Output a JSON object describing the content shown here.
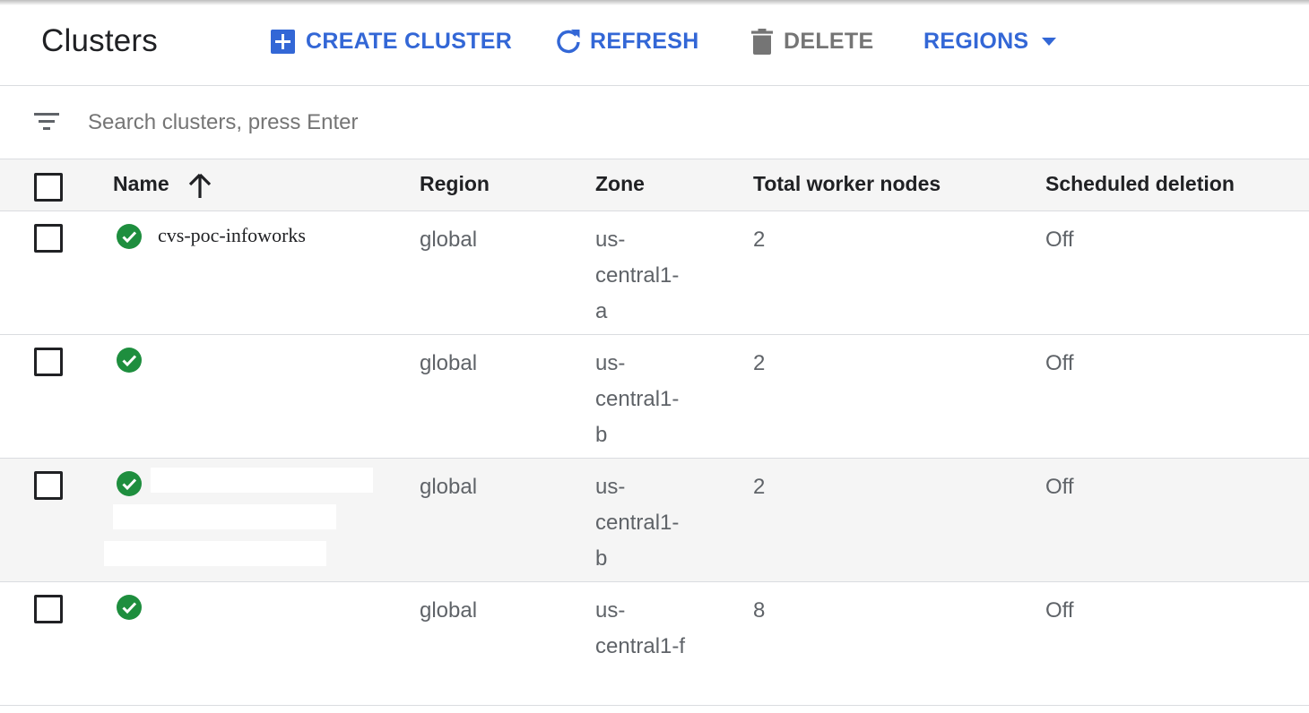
{
  "header": {
    "title": "Clusters",
    "create_label": "CREATE CLUSTER",
    "refresh_label": "REFRESH",
    "delete_label": "DELETE",
    "regions_label": "REGIONS"
  },
  "search": {
    "placeholder": "Search clusters, press Enter"
  },
  "table": {
    "columns": {
      "name": "Name",
      "region": "Region",
      "zone": "Zone",
      "workers": "Total worker nodes",
      "deletion": "Scheduled deletion"
    },
    "rows": [
      {
        "name": "cvs-poc-infoworks",
        "region": "global",
        "zone": [
          "us-",
          "central1-",
          "a"
        ],
        "workers": "2",
        "deletion": "Off"
      },
      {
        "name": "",
        "region": "global",
        "zone": [
          "us-",
          "central1-",
          "b"
        ],
        "workers": "2",
        "deletion": "Off"
      },
      {
        "name": "",
        "region": "global",
        "zone": [
          "us-",
          "central1-",
          "b"
        ],
        "workers": "2",
        "deletion": "Off"
      },
      {
        "name": "",
        "region": "global",
        "zone": [
          "us-",
          "central1-f",
          ""
        ],
        "workers": "8",
        "deletion": "Off"
      }
    ]
  },
  "colors": {
    "accent": "#3367d6",
    "status_ok": "#1e8e3e",
    "disabled": "#757575"
  },
  "icons": {
    "create": "add-box-icon",
    "refresh": "refresh-icon",
    "delete": "trash-icon",
    "regions": "caret-down-icon",
    "filter": "filter-list-icon",
    "sort": "arrow-up-icon",
    "status": "check-circle-icon"
  }
}
